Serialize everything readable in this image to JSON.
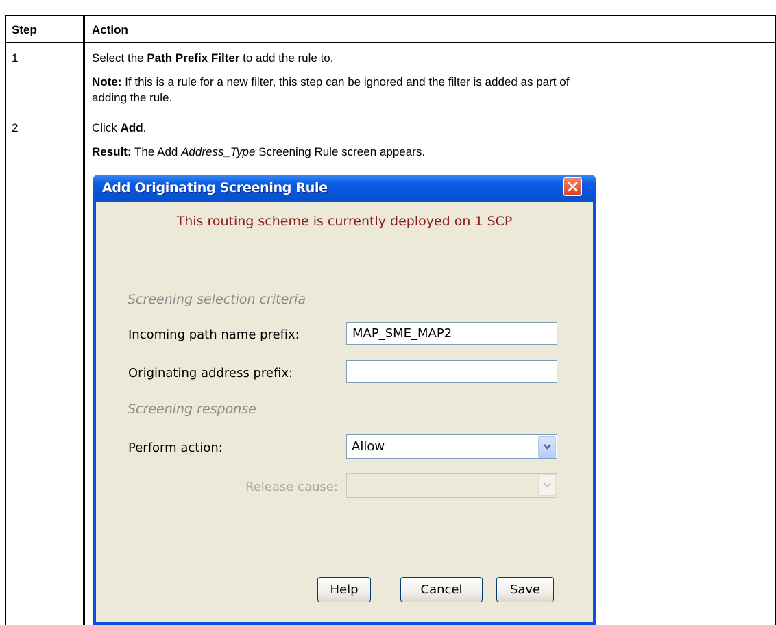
{
  "table": {
    "headers": {
      "step": "Step",
      "action": "Action"
    },
    "rows": [
      {
        "step": "1",
        "line1_prefix": "Select the ",
        "line1_bold": "Path Prefix Filter",
        "line1_suffix": " to add the rule to.",
        "note_label": "Note:",
        "note_text_line1": " If this is a rule for a new filter, this step can be ignored and the filter is added as part of",
        "note_text_line2": "adding the rule."
      },
      {
        "step": "2",
        "line1_prefix": "Click ",
        "line1_bold": "Add",
        "line1_suffix": ".",
        "result_label": "Result:",
        "result_pre": " The Add ",
        "result_italic": "Address_Type",
        "result_post": " Screening Rule screen appears."
      }
    ]
  },
  "dialog": {
    "title": "Add Originating Screening Rule",
    "deploy_message": "This routing scheme is currently deployed on 1 SCP",
    "section_criteria": "Screening selection criteria",
    "incoming_label": "Incoming path name prefix:",
    "incoming_value": "MAP_SME_MAP2",
    "originating_label": "Originating address prefix:",
    "originating_value": "",
    "section_response": "Screening response",
    "action_label": "Perform action:",
    "action_value": "Allow",
    "release_label": "Release cause:",
    "release_value": "",
    "buttons": {
      "help": "Help",
      "cancel": "Cancel",
      "save": "Save"
    }
  },
  "icons": {
    "close": "close-icon",
    "dropdown": "chevron-down-icon"
  },
  "colors": {
    "title_bar": "#0654d6",
    "dialog_bg": "#ece9d8",
    "deploy_message": "#8c1a1a",
    "close_button": "#d9401f"
  }
}
